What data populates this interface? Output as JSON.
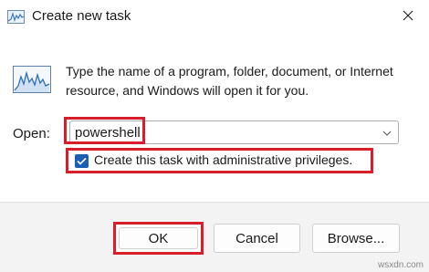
{
  "window": {
    "title": "Create new task",
    "title_icon": "run-icon",
    "close_icon": "close-icon"
  },
  "content": {
    "app_icon": "run-graph-icon",
    "description": "Type the name of a program, folder, document, or Internet resource, and Windows will open it for you.",
    "open_label": "Open:",
    "open_value": "powershell",
    "dropdown_icon": "chevron-down-icon",
    "admin_checkbox": {
      "checked": true,
      "label": "Create this task with administrative privileges."
    }
  },
  "buttons": {
    "ok": "OK",
    "cancel": "Cancel",
    "browse": "Browse..."
  },
  "watermark": "wsxdn.com",
  "colors": {
    "highlight": "#d81e2b",
    "checkbox": "#1a5fb4",
    "footer": "#f3f3f3"
  }
}
